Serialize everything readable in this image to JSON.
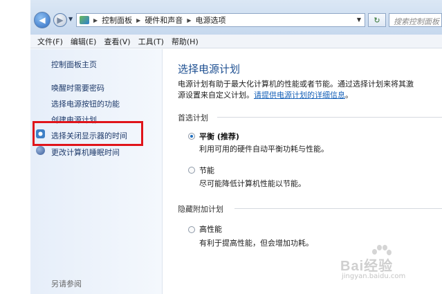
{
  "address_bar": {
    "breadcrumb": [
      "控制面板",
      "硬件和声音",
      "电源选项"
    ],
    "search_placeholder": "搜索控制面板"
  },
  "menu": [
    "文件(F)",
    "编辑(E)",
    "查看(V)",
    "工具(T)",
    "帮助(H)"
  ],
  "sidebar": {
    "items": [
      {
        "label": "控制面板主页",
        "icon": ""
      },
      {
        "label": "唤醒时需要密码",
        "icon": ""
      },
      {
        "label": "选择电源按钮的功能",
        "icon": ""
      },
      {
        "label": "创建电源计划",
        "icon": ""
      },
      {
        "label": "选择关闭显示器的时间",
        "icon": "monitor-icon"
      },
      {
        "label": "更改计算机睡眠时间",
        "icon": "sleep-icon"
      }
    ],
    "see_also": "另请参阅"
  },
  "highlight": {
    "color": "#e0141a"
  },
  "main": {
    "title": "选择电源计划",
    "description_line1": "电源计划有助于最大化计算机的性能或者节能。通过选择计划来将其激",
    "description_line2": "源设置来自定义计划。",
    "description_link": "请提供电源计划的详细信息",
    "description_end": "。",
    "groups": [
      {
        "header": "首选计划",
        "plans": [
          {
            "name": "平衡 (推荐)",
            "desc": "利用可用的硬件自动平衡功耗与性能。",
            "selected": true
          },
          {
            "name": "节能",
            "desc": "尽可能降低计算机性能以节能。",
            "selected": false
          }
        ]
      },
      {
        "header": "隐藏附加计划",
        "plans": [
          {
            "name": "高性能",
            "desc": "有利于提高性能，但会增加功耗。",
            "selected": false
          }
        ]
      }
    ]
  },
  "watermark": {
    "text": "Bai经验",
    "sub": "jingyan.baidu.com"
  },
  "colors": {
    "title": "#1d4f91",
    "link": "#1560b8",
    "sidebar_bg": "#e6eef9"
  }
}
